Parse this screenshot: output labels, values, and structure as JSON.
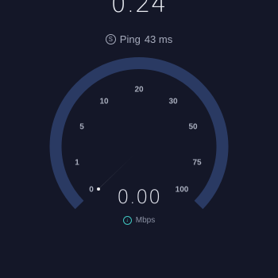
{
  "top_value": "0.24",
  "ping": {
    "label": "Ping",
    "value": "43 ms",
    "icon": "ping-icon"
  },
  "gauge": {
    "ticks": [
      "0",
      "1",
      "5",
      "10",
      "20",
      "30",
      "50",
      "75",
      "100"
    ],
    "readout": "0.00",
    "unit": "Mbps",
    "unit_icon": "download-arrow-icon",
    "track_color": "#2a3a63",
    "needle_color": "#ffffff",
    "accent_color": "#3fc6c0"
  }
}
